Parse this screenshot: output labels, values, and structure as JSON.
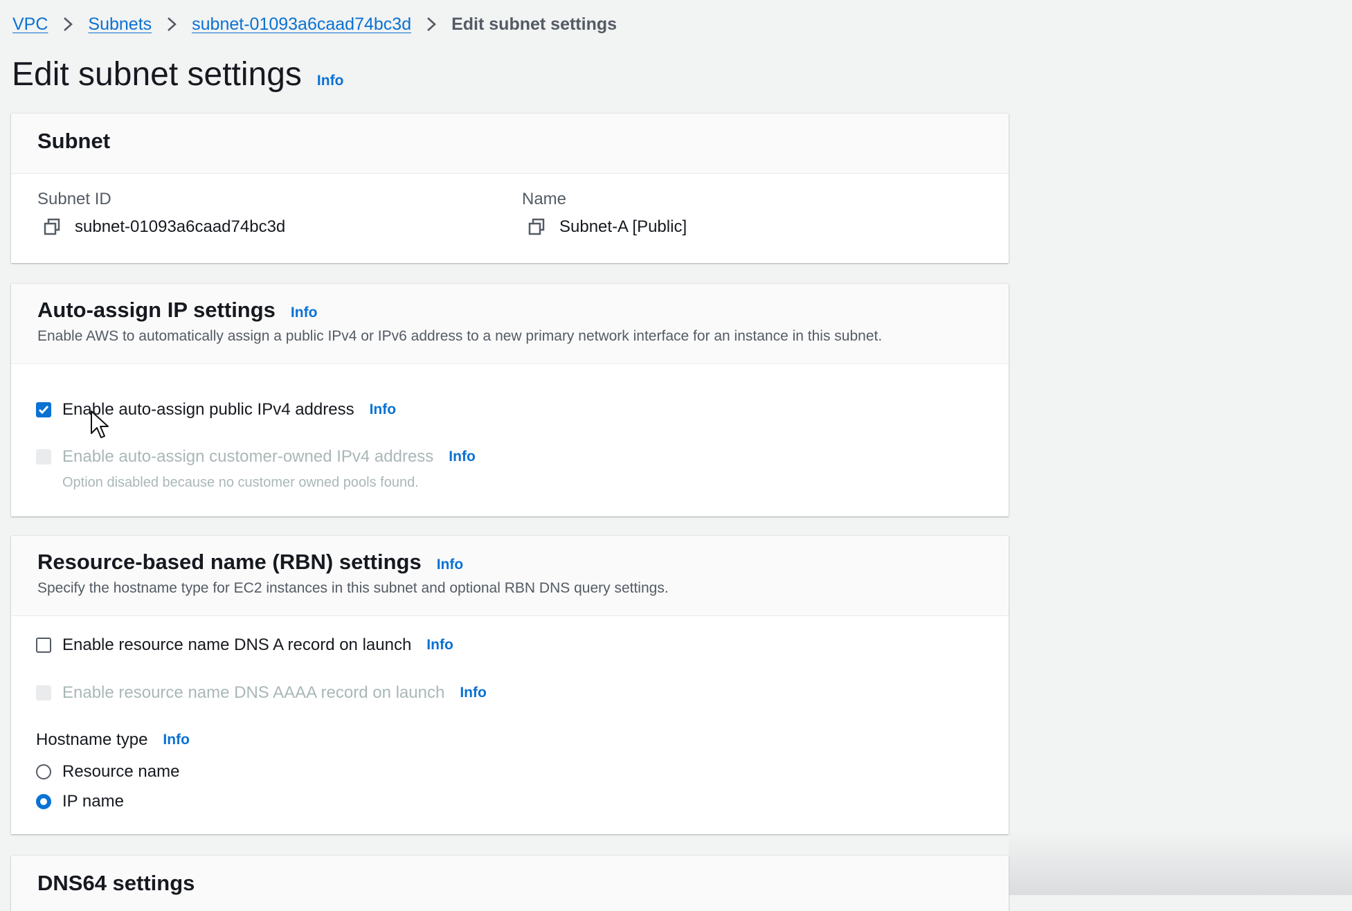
{
  "breadcrumb": {
    "items": [
      "VPC",
      "Subnets",
      "subnet-01093a6caad74bc3d"
    ],
    "current": "Edit subnet settings"
  },
  "page": {
    "title": "Edit subnet settings",
    "info": "Info"
  },
  "subnet_panel": {
    "title": "Subnet",
    "subnet_id_label": "Subnet ID",
    "subnet_id_value": "subnet-01093a6caad74bc3d",
    "name_label": "Name",
    "name_value": "Subnet-A [Public]"
  },
  "auto_assign_panel": {
    "title": "Auto-assign IP settings",
    "info": "Info",
    "description": "Enable AWS to automatically assign a public IPv4 or IPv6 address to a new primary network interface for an instance in this subnet.",
    "options": [
      {
        "label": "Enable auto-assign public IPv4 address",
        "info": "Info",
        "checked": true,
        "disabled": false
      },
      {
        "label": "Enable auto-assign customer-owned IPv4 address",
        "info": "Info",
        "checked": false,
        "disabled": true,
        "subtext": "Option disabled because no customer owned pools found."
      }
    ]
  },
  "rbn_panel": {
    "title": "Resource-based name (RBN) settings",
    "info": "Info",
    "description": "Specify the hostname type for EC2 instances in this subnet and optional RBN DNS query settings.",
    "options": [
      {
        "label": "Enable resource name DNS A record on launch",
        "info": "Info",
        "checked": false,
        "disabled": false
      },
      {
        "label": "Enable resource name DNS AAAA record on launch",
        "info": "Info",
        "checked": false,
        "disabled": true
      }
    ],
    "hostname_type": {
      "label": "Hostname type",
      "info": "Info",
      "choices": [
        {
          "label": "Resource name",
          "selected": false
        },
        {
          "label": "IP name",
          "selected": true
        }
      ]
    }
  },
  "dns64_panel": {
    "title": "DNS64 settings"
  },
  "colors": {
    "link": "#0972d3",
    "background": "#f2f3f3",
    "disabled_text": "#aab7b8"
  }
}
